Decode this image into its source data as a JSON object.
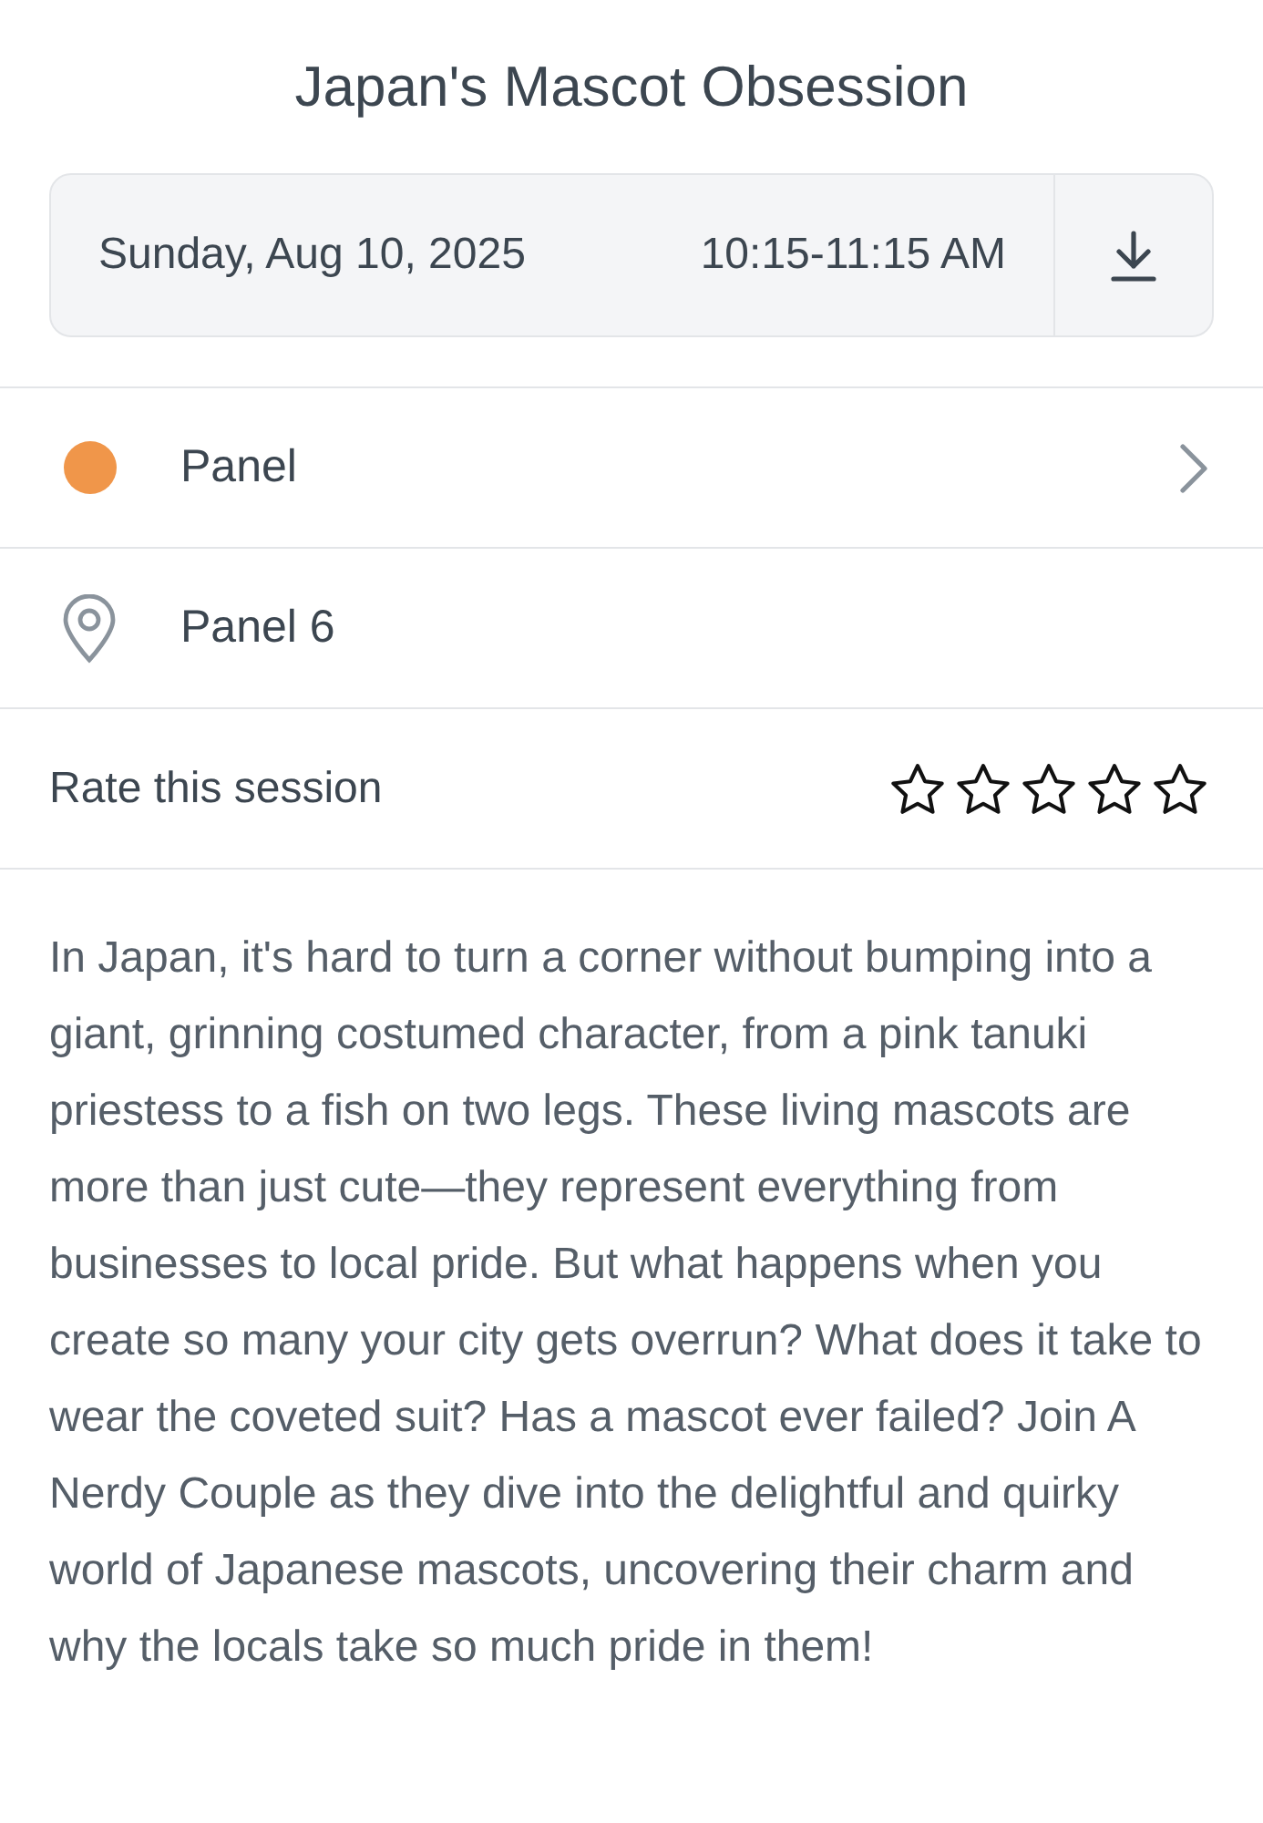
{
  "title": "Japan's Mascot Obsession",
  "schedule": {
    "date": "Sunday, Aug 10, 2025",
    "time": "10:15-11:15 AM"
  },
  "track": {
    "label": "Panel",
    "color": "#f0964a"
  },
  "location": {
    "label": "Panel 6"
  },
  "rating": {
    "label": "Rate this session",
    "stars": 0
  },
  "description": "In Japan, it's hard to turn a corner without bumping into a giant, grinning costumed character, from a pink tanuki priestess to a fish on two legs. These living mascots are more than just cute—they represent everything from businesses to local pride. But what happens when you create so many your city gets overrun? What does it take to wear the coveted suit? Has a mascot ever failed? Join A Nerdy Couple as they dive into the delightful and quirky world of Japanese mascots, uncovering their charm and why the locals take so much pride in them!"
}
